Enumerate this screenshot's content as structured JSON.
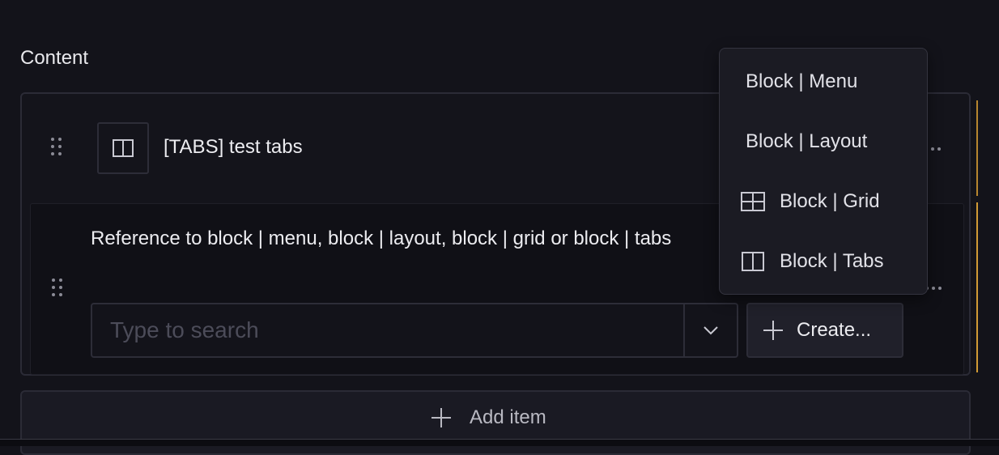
{
  "section": {
    "label": "Content"
  },
  "item": {
    "title": "[TABS] test tabs",
    "icon": "tabs-icon"
  },
  "reference": {
    "label": "Reference to block | menu, block | layout, block | grid or block | tabs",
    "search_placeholder": "Type to search",
    "create_label": "Create..."
  },
  "add_item": {
    "label": "Add item"
  },
  "dropdown": {
    "items": [
      {
        "label": "Block | Menu",
        "icon": ""
      },
      {
        "label": "Block | Layout",
        "icon": ""
      },
      {
        "label": "Block | Grid",
        "icon": "grid-icon"
      },
      {
        "label": "Block | Tabs",
        "icon": "tabs-icon"
      }
    ]
  },
  "colors": {
    "background": "#13131a",
    "accent": "#d19a34",
    "border": "#2b2b36"
  }
}
